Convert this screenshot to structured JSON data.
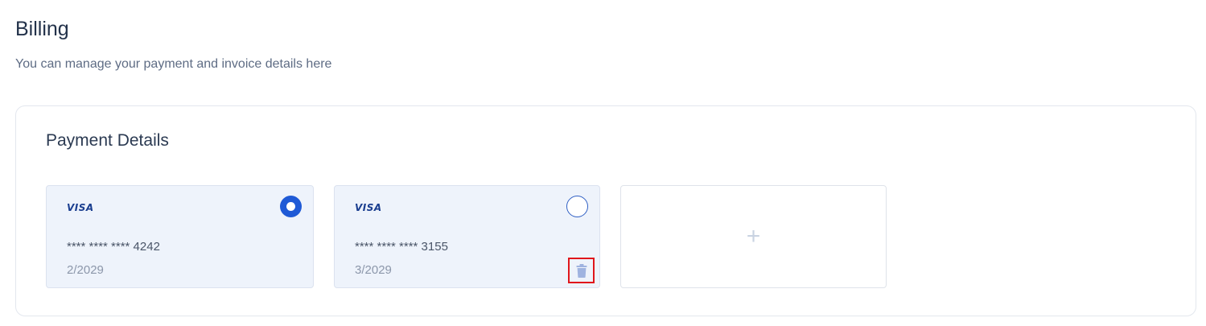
{
  "header": {
    "title": "Billing",
    "subtitle": "You can manage your payment and invoice details here"
  },
  "payment": {
    "section_title": "Payment Details",
    "cards": [
      {
        "brand": "VISA",
        "masked_number": "**** **** **** 4242",
        "expiry": "2/2029",
        "selected": true
      },
      {
        "brand": "VISA",
        "masked_number": "**** **** **** 3155",
        "expiry": "3/2029",
        "selected": false
      }
    ],
    "add_card_symbol": "+"
  },
  "colors": {
    "accent": "#1f5ad6",
    "card_bg": "#eef3fb",
    "delete_highlight": "#e0161b",
    "trash_icon": "#9fb3e0"
  },
  "icons": {
    "selected_radio": "radio-selected-icon",
    "unselected_radio": "radio-unselected-icon",
    "delete": "trash-icon",
    "add": "plus-icon"
  }
}
